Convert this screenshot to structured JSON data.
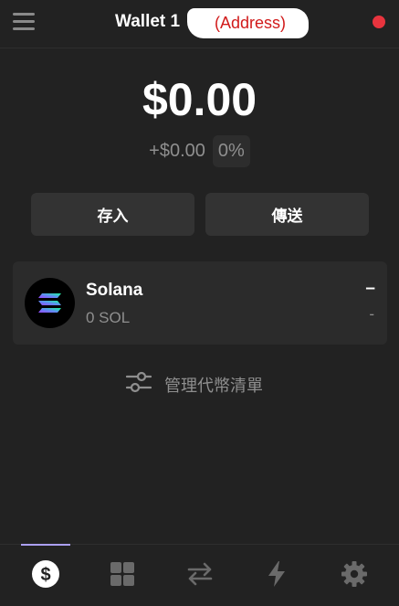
{
  "header": {
    "wallet_name": "Wallet 1",
    "address_label": "(Address)",
    "menu_icon": "hamburger-menu-icon",
    "status_color": "#e8343e"
  },
  "balance": {
    "total": "$0.00",
    "change_amount": "+$0.00",
    "change_percent": "0%"
  },
  "actions": {
    "deposit_label": "存入",
    "send_label": "傳送"
  },
  "tokens": [
    {
      "name": "Solana",
      "amount": "0 SOL",
      "value": "–",
      "change": "-",
      "icon": "solana-logo-icon"
    }
  ],
  "manage": {
    "label": "管理代幣清單",
    "icon": "sliders-icon"
  },
  "tabbar": {
    "active_tab": "wallet",
    "accent_color": "#ab9ff2",
    "tabs": [
      {
        "id": "wallet",
        "icon": "dollar-icon"
      },
      {
        "id": "collectibles",
        "icon": "grid-icon"
      },
      {
        "id": "swap",
        "icon": "swap-arrows-icon"
      },
      {
        "id": "activity",
        "icon": "lightning-icon"
      },
      {
        "id": "settings",
        "icon": "gear-icon"
      }
    ]
  }
}
